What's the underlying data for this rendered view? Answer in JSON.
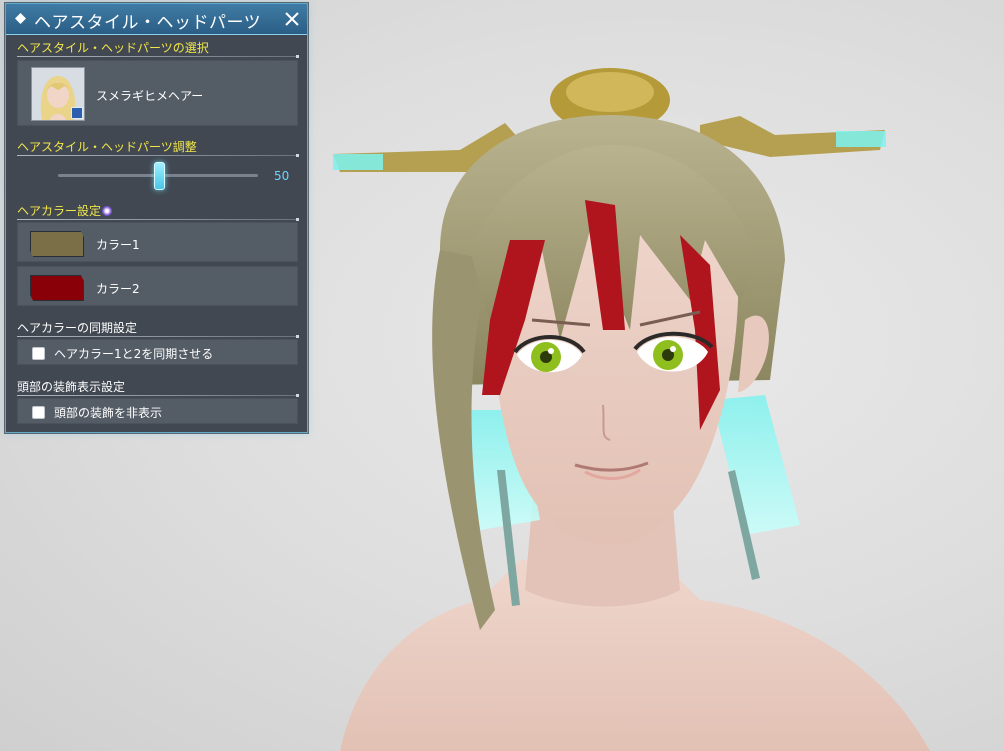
{
  "panel": {
    "title": "ヘアスタイル・ヘッドパーツ",
    "hairstyle_section": {
      "label": "ヘアスタイル・ヘッドパーツの選択",
      "selected_name": "スメラギヒメヘアー"
    },
    "adjust_section": {
      "label": "ヘアスタイル・ヘッドパーツ調整",
      "value": "50",
      "fraction": 0.5
    },
    "color_section": {
      "label": "ヘアカラー設定",
      "colors": [
        {
          "label": "カラー1",
          "hex": "#7b6f47"
        },
        {
          "label": "カラー2",
          "hex": "#8a0008"
        }
      ]
    },
    "sync_section": {
      "label": "ヘアカラーの同期設定",
      "option": "ヘアカラー1と2を同期させる",
      "checked": false
    },
    "head_decor_section": {
      "label": "頭部の装飾表示設定",
      "option": "頭部の装飾を非表示",
      "checked": false
    }
  }
}
